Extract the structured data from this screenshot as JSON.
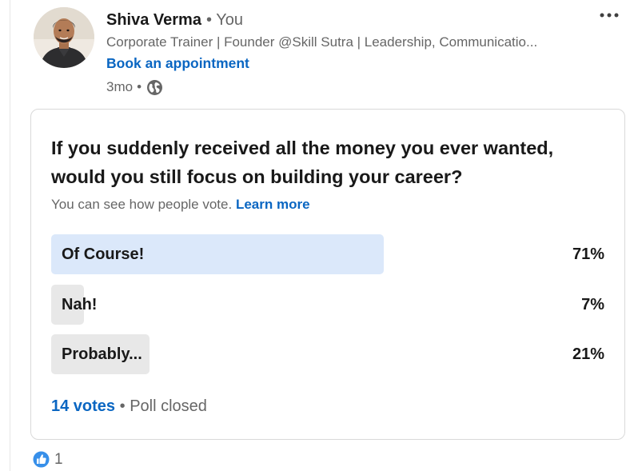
{
  "post": {
    "author_name": "Shiva Verma",
    "you_badge": "• You",
    "headline": "Corporate Trainer | Founder @Skill Sutra | Leadership, Communicatio...",
    "cta_link": "Book an appointment",
    "time_ago": "3mo",
    "meta_separator": "•",
    "visibility_icon": "globe-icon",
    "more_icon": "more-horizontal-icon"
  },
  "poll": {
    "question": "If you suddenly received all the money you ever wanted, would you still focus on building your career?",
    "visibility_note": "You can see how people vote.",
    "learn_more": "Learn more",
    "options": [
      {
        "label": "Of Course!",
        "percent_label": "71%",
        "share": 0.71,
        "fill_color": "#dbe8fa",
        "selected": true
      },
      {
        "label": "Nah!",
        "percent_label": "7%",
        "share": 0.07,
        "fill_color": "#e8e8e8",
        "selected": false
      },
      {
        "label": "Probably...",
        "percent_label": "21%",
        "share": 0.21,
        "fill_color": "#e8e8e8",
        "selected": false
      }
    ],
    "votes": "14 votes",
    "separator": "•",
    "status": "Poll closed"
  },
  "reactions": {
    "icon": "like-icon",
    "count": "1"
  },
  "colors": {
    "link_blue": "#0a66c2",
    "selected_fill": "#dbe8fa",
    "unselected_fill": "#e8e8e8",
    "muted_text": "#666666"
  }
}
